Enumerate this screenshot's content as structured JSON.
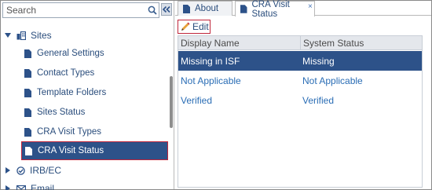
{
  "search": {
    "placeholder": "Search"
  },
  "tree": {
    "sites_label": "Sites",
    "children": [
      {
        "label": "General Settings"
      },
      {
        "label": "Contact Types"
      },
      {
        "label": "Template Folders"
      },
      {
        "label": "Sites Status"
      },
      {
        "label": "CRA Visit Types"
      },
      {
        "label": "CRA Visit Status"
      }
    ],
    "irb_label": "IRB/EC",
    "email_label": "Email"
  },
  "tabs": [
    {
      "label": "About"
    },
    {
      "label": "CRA Visit Status",
      "close": "×"
    }
  ],
  "toolbar": {
    "edit_label": "Edit"
  },
  "grid": {
    "columns": [
      "Display Name",
      "System Status"
    ],
    "rows": [
      {
        "display_name": "Missing in ISF",
        "system_status": "Missing"
      },
      {
        "display_name": "Not Applicable",
        "system_status": "Not Applicable"
      },
      {
        "display_name": "Verified",
        "system_status": "Verified"
      }
    ]
  },
  "colors": {
    "accent": "#2d5289",
    "highlight_border": "#c0263b",
    "link": "#2a6db5"
  }
}
